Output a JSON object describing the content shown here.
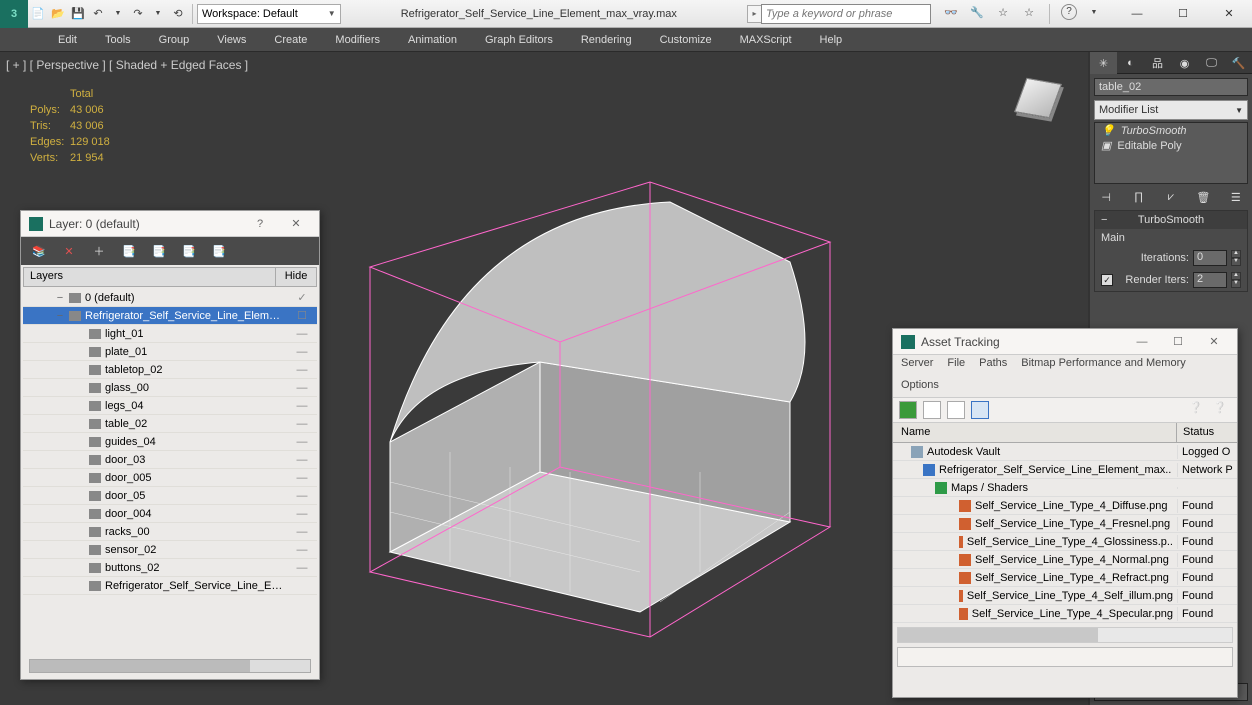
{
  "titlebar": {
    "workspace_label": "Workspace: Default",
    "filename": "Refrigerator_Self_Service_Line_Element_max_vray.max",
    "search_placeholder": "Type a keyword or phrase"
  },
  "menu": [
    "Edit",
    "Tools",
    "Group",
    "Views",
    "Create",
    "Modifiers",
    "Animation",
    "Graph Editors",
    "Rendering",
    "Customize",
    "MAXScript",
    "Help"
  ],
  "viewport": {
    "label": "[ + ] [ Perspective ] [ Shaded + Edged Faces ]",
    "stats_header": "Total",
    "stats": [
      {
        "label": "Polys:",
        "value": "43 006"
      },
      {
        "label": "Tris:",
        "value": "43 006"
      },
      {
        "label": "Edges:",
        "value": "129 018"
      },
      {
        "label": "Verts:",
        "value": "21 954"
      }
    ]
  },
  "cmdpanel": {
    "object_name": "table_02",
    "modifier_list": "Modifier List",
    "stack": [
      "TurboSmooth",
      "Editable Poly"
    ],
    "rollout_title": "TurboSmooth",
    "sub_label": "Main",
    "params": [
      {
        "label": "Iterations:",
        "value": "0",
        "checked": false
      },
      {
        "label": "Render Iters:",
        "value": "2",
        "checked": true
      }
    ]
  },
  "layer_window": {
    "title": "Layer: 0 (default)",
    "help": "?",
    "columns": {
      "c1": "Layers",
      "c2": "Hide"
    },
    "rows": [
      {
        "type": "layer",
        "text": "0 (default)",
        "indent": 1,
        "twist": "−",
        "hide": "✓"
      },
      {
        "type": "layer",
        "text": "Refrigerator_Self_Service_Line_Element",
        "indent": 1,
        "twist": "−",
        "selected": true,
        "box": true
      },
      {
        "type": "obj",
        "text": "light_01",
        "indent": 2,
        "hide": "—"
      },
      {
        "type": "obj",
        "text": "plate_01",
        "indent": 2,
        "hide": "—"
      },
      {
        "type": "obj",
        "text": "tabletop_02",
        "indent": 2,
        "hide": "—"
      },
      {
        "type": "obj",
        "text": "glass_00",
        "indent": 2,
        "hide": "—"
      },
      {
        "type": "obj",
        "text": "legs_04",
        "indent": 2,
        "hide": "—"
      },
      {
        "type": "obj",
        "text": "table_02",
        "indent": 2,
        "hide": "—"
      },
      {
        "type": "obj",
        "text": "guides_04",
        "indent": 2,
        "hide": "—"
      },
      {
        "type": "obj",
        "text": "door_03",
        "indent": 2,
        "hide": "—"
      },
      {
        "type": "obj",
        "text": "door_005",
        "indent": 2,
        "hide": "—"
      },
      {
        "type": "obj",
        "text": "door_05",
        "indent": 2,
        "hide": "—"
      },
      {
        "type": "obj",
        "text": "door_004",
        "indent": 2,
        "hide": "—"
      },
      {
        "type": "obj",
        "text": "racks_00",
        "indent": 2,
        "hide": "—"
      },
      {
        "type": "obj",
        "text": "sensor_02",
        "indent": 2,
        "hide": "—"
      },
      {
        "type": "obj",
        "text": "buttons_02",
        "indent": 2,
        "hide": "—"
      },
      {
        "type": "obj",
        "text": "Refrigerator_Self_Service_Line_Element",
        "indent": 2,
        "hide": ""
      }
    ]
  },
  "asset_window": {
    "title": "Asset Tracking",
    "menu1": [
      "Server",
      "File",
      "Paths",
      "Bitmap Performance and Memory"
    ],
    "menu2": "Options",
    "columns": {
      "c1": "Name",
      "c2": "Status"
    },
    "rows": [
      {
        "icon": "#8aa3b8",
        "indent": 18,
        "text": "Autodesk Vault",
        "status": "Logged O"
      },
      {
        "icon": "#3a74c4",
        "indent": 30,
        "text": "Refrigerator_Self_Service_Line_Element_max..",
        "status": "Network P"
      },
      {
        "icon": "#2e9a47",
        "indent": 42,
        "text": "Maps / Shaders",
        "status": ""
      },
      {
        "icon": "#d06030",
        "indent": 66,
        "text": "Self_Service_Line_Type_4_Diffuse.png",
        "status": "Found"
      },
      {
        "icon": "#d06030",
        "indent": 66,
        "text": "Self_Service_Line_Type_4_Fresnel.png",
        "status": "Found"
      },
      {
        "icon": "#d06030",
        "indent": 66,
        "text": "Self_Service_Line_Type_4_Glossiness.p..",
        "status": "Found"
      },
      {
        "icon": "#d06030",
        "indent": 66,
        "text": "Self_Service_Line_Type_4_Normal.png",
        "status": "Found"
      },
      {
        "icon": "#d06030",
        "indent": 66,
        "text": "Self_Service_Line_Type_4_Refract.png",
        "status": "Found"
      },
      {
        "icon": "#d06030",
        "indent": 66,
        "text": "Self_Service_Line_Type_4_Self_illum.png",
        "status": "Found"
      },
      {
        "icon": "#d06030",
        "indent": 66,
        "text": "Self_Service_Line_Type_4_Specular.png",
        "status": "Found"
      }
    ]
  }
}
